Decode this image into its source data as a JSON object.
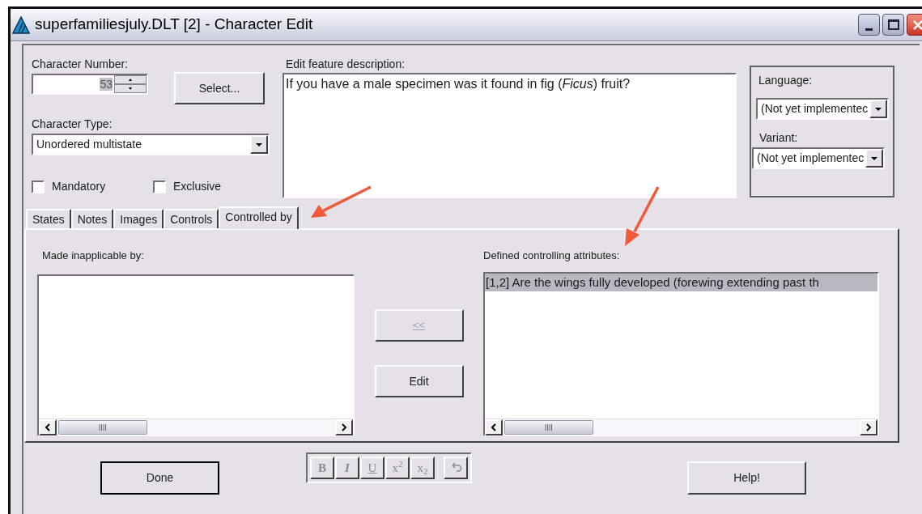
{
  "window": {
    "title": "superfamiliesjuly.DLT [2] - Character Edit"
  },
  "character_number": {
    "label": "Character Number:",
    "value": "53"
  },
  "select_button": "Select...",
  "character_type": {
    "label": "Character Type:",
    "value": "Unordered multistate"
  },
  "checkboxes": [
    {
      "label": "Mandatory",
      "checked": false
    },
    {
      "label": "Exclusive",
      "checked": false
    }
  ],
  "description": {
    "label": "Edit feature description:",
    "value": "If you have a male specimen was it found in fig (*Ficus*) fruit?"
  },
  "language": {
    "label": "Language:",
    "value": "(Not yet implementec"
  },
  "variant": {
    "label": "Variant:",
    "value": "(Not yet implementec"
  },
  "tabs": [
    {
      "label": "States",
      "selected": false
    },
    {
      "label": "Notes",
      "selected": false
    },
    {
      "label": "Images",
      "selected": false
    },
    {
      "label": "Controls",
      "selected": false
    },
    {
      "label": "Controlled by",
      "selected": true
    }
  ],
  "made_inapplicable_by": {
    "label": "Made inapplicable by:"
  },
  "move_button": {
    "label": "<<",
    "disabled": true
  },
  "edit_button": "Edit",
  "defined_controlling_attributes": {
    "label": "Defined controlling attributes:",
    "items": [
      {
        "text": "[1,2] Are the wings fully developed (forewing extending past th",
        "selected": true
      }
    ]
  },
  "done_button": "Done",
  "format_toolbar": {
    "disabled": true,
    "buttons": [
      {
        "kind": "bold",
        "label": "B"
      },
      {
        "kind": "italic",
        "label": "I"
      },
      {
        "kind": "underline",
        "label": "U"
      },
      {
        "kind": "plain",
        "label": "x$^{2}$"
      },
      {
        "kind": "plain",
        "label": "x$_{2}$"
      }
    ]
  },
  "help_button": "Help!"
}
